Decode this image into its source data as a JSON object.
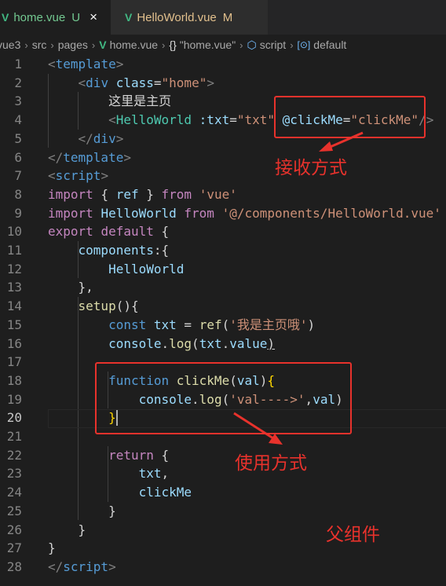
{
  "tabs": [
    {
      "icon": "vue-icon",
      "name": "home.vue",
      "badge": "U",
      "close": "×",
      "active": true
    },
    {
      "icon": "vue-icon",
      "name": "HelloWorld.vue",
      "badge": "M",
      "active": false
    }
  ],
  "breadcrumbs": [
    "vue3",
    "src",
    "pages",
    "home.vue",
    "\"home.vue\"",
    "script",
    "default"
  ],
  "line_numbers": [
    "1",
    "2",
    "3",
    "4",
    "5",
    "6",
    "7",
    "8",
    "9",
    "10",
    "11",
    "12",
    "13",
    "14",
    "15",
    "16",
    "17",
    "18",
    "19",
    "20",
    "21",
    "22",
    "23",
    "24",
    "25",
    "26",
    "27",
    "28"
  ],
  "current_line": "20",
  "code_lines": [
    [
      [
        "tg",
        "<"
      ],
      [
        "tn",
        "template"
      ],
      [
        "tg",
        ">"
      ]
    ],
    [
      [
        "tx",
        "    "
      ],
      [
        "tg",
        "<"
      ],
      [
        "tn",
        "div"
      ],
      [
        "tx",
        " "
      ],
      [
        "at",
        "class"
      ],
      [
        "tx",
        "="
      ],
      [
        "st",
        "\"home\""
      ],
      [
        "tg",
        ">"
      ]
    ],
    [
      [
        "tx",
        "        这里是主页"
      ]
    ],
    [
      [
        "tx",
        "        "
      ],
      [
        "tg",
        "<"
      ],
      [
        "cl",
        "HelloWorld"
      ],
      [
        "tx",
        " "
      ],
      [
        "at",
        ":txt"
      ],
      [
        "tx",
        "="
      ],
      [
        "st",
        "\"txt\""
      ],
      [
        "tx",
        " "
      ],
      [
        "at",
        "@clickMe"
      ],
      [
        "tx",
        "="
      ],
      [
        "st",
        "\"clickMe\""
      ],
      [
        "tg",
        "/>"
      ]
    ],
    [
      [
        "tx",
        "    "
      ],
      [
        "tg",
        "</"
      ],
      [
        "tn",
        "div"
      ],
      [
        "tg",
        ">"
      ]
    ],
    [
      [
        "tg",
        "</"
      ],
      [
        "tn",
        "template"
      ],
      [
        "tg",
        ">"
      ]
    ],
    [
      [
        "tg",
        "<"
      ],
      [
        "tn",
        "script"
      ],
      [
        "tg",
        ">"
      ]
    ],
    [
      [
        "kw",
        "import"
      ],
      [
        "tx",
        " { "
      ],
      [
        "vr",
        "ref"
      ],
      [
        "tx",
        " } "
      ],
      [
        "kw",
        "from"
      ],
      [
        "tx",
        " "
      ],
      [
        "st",
        "'vue'"
      ]
    ],
    [
      [
        "kw",
        "import"
      ],
      [
        "tx",
        " "
      ],
      [
        "vr",
        "HelloWorld"
      ],
      [
        "tx",
        " "
      ],
      [
        "kw",
        "from"
      ],
      [
        "tx",
        " "
      ],
      [
        "st",
        "'@/components/HelloWorld.vue'"
      ]
    ],
    [
      [
        "kw",
        "export"
      ],
      [
        "tx",
        " "
      ],
      [
        "kw",
        "default"
      ],
      [
        "tx",
        " {"
      ]
    ],
    [
      [
        "tx",
        "    "
      ],
      [
        "vr",
        "components"
      ],
      [
        "tx",
        ":{"
      ]
    ],
    [
      [
        "tx",
        "        "
      ],
      [
        "vr",
        "HelloWorld"
      ]
    ],
    [
      [
        "tx",
        "    },"
      ]
    ],
    [
      [
        "tx",
        "    "
      ],
      [
        "fn",
        "setup"
      ],
      [
        "tx",
        "(){"
      ]
    ],
    [
      [
        "tx",
        "        "
      ],
      [
        "bl",
        "const"
      ],
      [
        "tx",
        " "
      ],
      [
        "vr",
        "txt"
      ],
      [
        "tx",
        " = "
      ],
      [
        "fn",
        "ref"
      ],
      [
        "tx",
        "("
      ],
      [
        "st",
        "'我是主页哦'"
      ],
      [
        "tx",
        ")"
      ]
    ],
    [
      [
        "tx",
        "        "
      ],
      [
        "vr",
        "console"
      ],
      [
        "tx",
        "."
      ],
      [
        "fn",
        "log"
      ],
      [
        "tx",
        "("
      ],
      [
        "vr",
        "txt"
      ],
      [
        "tx",
        "."
      ],
      [
        "vr",
        "value"
      ],
      [
        "tx",
        ")"
      ]
    ],
    [
      [
        "tx",
        ""
      ]
    ],
    [
      [
        "tx",
        "        "
      ],
      [
        "bl",
        "function"
      ],
      [
        "tx",
        " "
      ],
      [
        "fn",
        "clickMe"
      ],
      [
        "tx",
        "("
      ],
      [
        "vr",
        "val"
      ],
      [
        "tx",
        ")"
      ],
      [
        "br",
        "{"
      ]
    ],
    [
      [
        "tx",
        "            "
      ],
      [
        "vr",
        "console"
      ],
      [
        "tx",
        "."
      ],
      [
        "fn",
        "log"
      ],
      [
        "tx",
        "("
      ],
      [
        "st",
        "'val---->'"
      ],
      [
        "tx",
        ","
      ],
      [
        "vr",
        "val"
      ],
      [
        "tx",
        ")"
      ]
    ],
    [
      [
        "tx",
        "        "
      ],
      [
        "br",
        "}"
      ]
    ],
    [
      [
        "tx",
        ""
      ]
    ],
    [
      [
        "tx",
        "        "
      ],
      [
        "kw",
        "return"
      ],
      [
        "tx",
        " {"
      ]
    ],
    [
      [
        "tx",
        "            "
      ],
      [
        "vr",
        "txt"
      ],
      [
        "tx",
        ","
      ]
    ],
    [
      [
        "tx",
        "            "
      ],
      [
        "vr",
        "clickMe"
      ]
    ],
    [
      [
        "tx",
        "        }"
      ]
    ],
    [
      [
        "tx",
        "    }"
      ]
    ],
    [
      [
        "tx",
        "}"
      ]
    ],
    [
      [
        "tg",
        "</"
      ],
      [
        "tn",
        "script"
      ],
      [
        "tg",
        ">"
      ]
    ]
  ],
  "annotations": {
    "receive": "接收方式",
    "use": "使用方式",
    "parent": "父组件"
  },
  "colors": {
    "annotation": "#e8322c",
    "background": "#1e1e1e"
  }
}
